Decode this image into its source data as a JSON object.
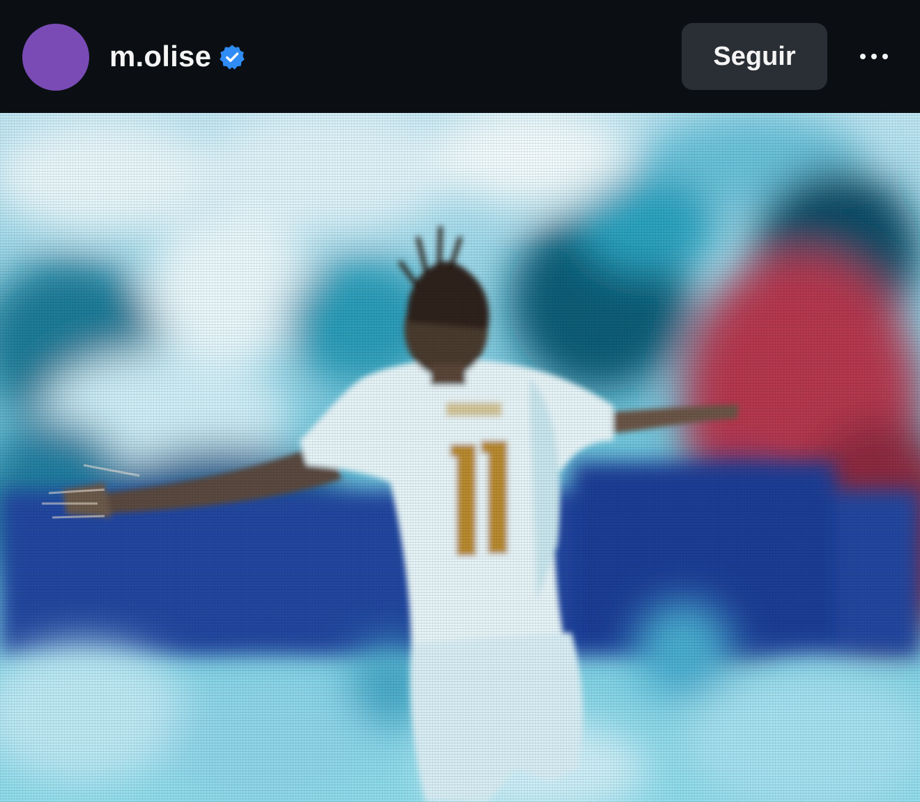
{
  "post": {
    "username": "m.olise",
    "verified": true,
    "follow_label": "Seguir",
    "avatar_color": "#7a4bb5",
    "menu_icon": "more-horizontal-icon",
    "media": {
      "kind": "photo",
      "jersey_number": "11"
    }
  },
  "colors": {
    "header_background": "#0b0f14",
    "button_background": "#2a2e35",
    "verified_badge": "#2f8cf5",
    "text": "#f5f5f5"
  }
}
